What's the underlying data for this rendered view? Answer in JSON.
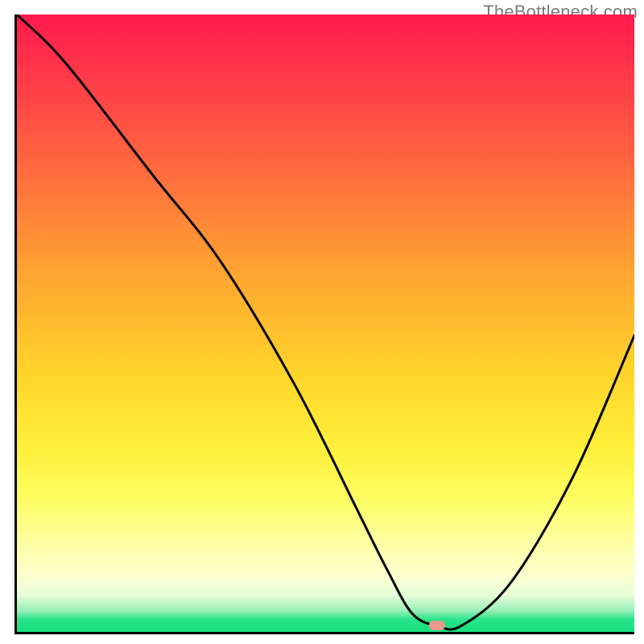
{
  "watermark": "TheBottleneck.com",
  "chart_data": {
    "type": "line",
    "title": "",
    "xlabel": "",
    "ylabel": "",
    "xlim": [
      0,
      100
    ],
    "ylim": [
      0,
      100
    ],
    "grid": false,
    "legend": false,
    "series": [
      {
        "name": "bottleneck-curve",
        "x": [
          0,
          8,
          22,
          33,
          45,
          55,
          60,
          64,
          68,
          72,
          80,
          90,
          100
        ],
        "y": [
          100,
          92,
          74,
          60,
          40,
          20,
          10,
          3,
          1,
          1,
          8,
          25,
          48
        ]
      }
    ],
    "marker": {
      "x": 68,
      "y": 1
    },
    "background_gradient": {
      "stops": [
        {
          "pct": 0,
          "color": "#ff1a4d"
        },
        {
          "pct": 25,
          "color": "#ff6a3e"
        },
        {
          "pct": 58,
          "color": "#ffd42a"
        },
        {
          "pct": 85,
          "color": "#feff9e"
        },
        {
          "pct": 98,
          "color": "#29e38a"
        },
        {
          "pct": 100,
          "color": "#16e07e"
        }
      ]
    }
  }
}
